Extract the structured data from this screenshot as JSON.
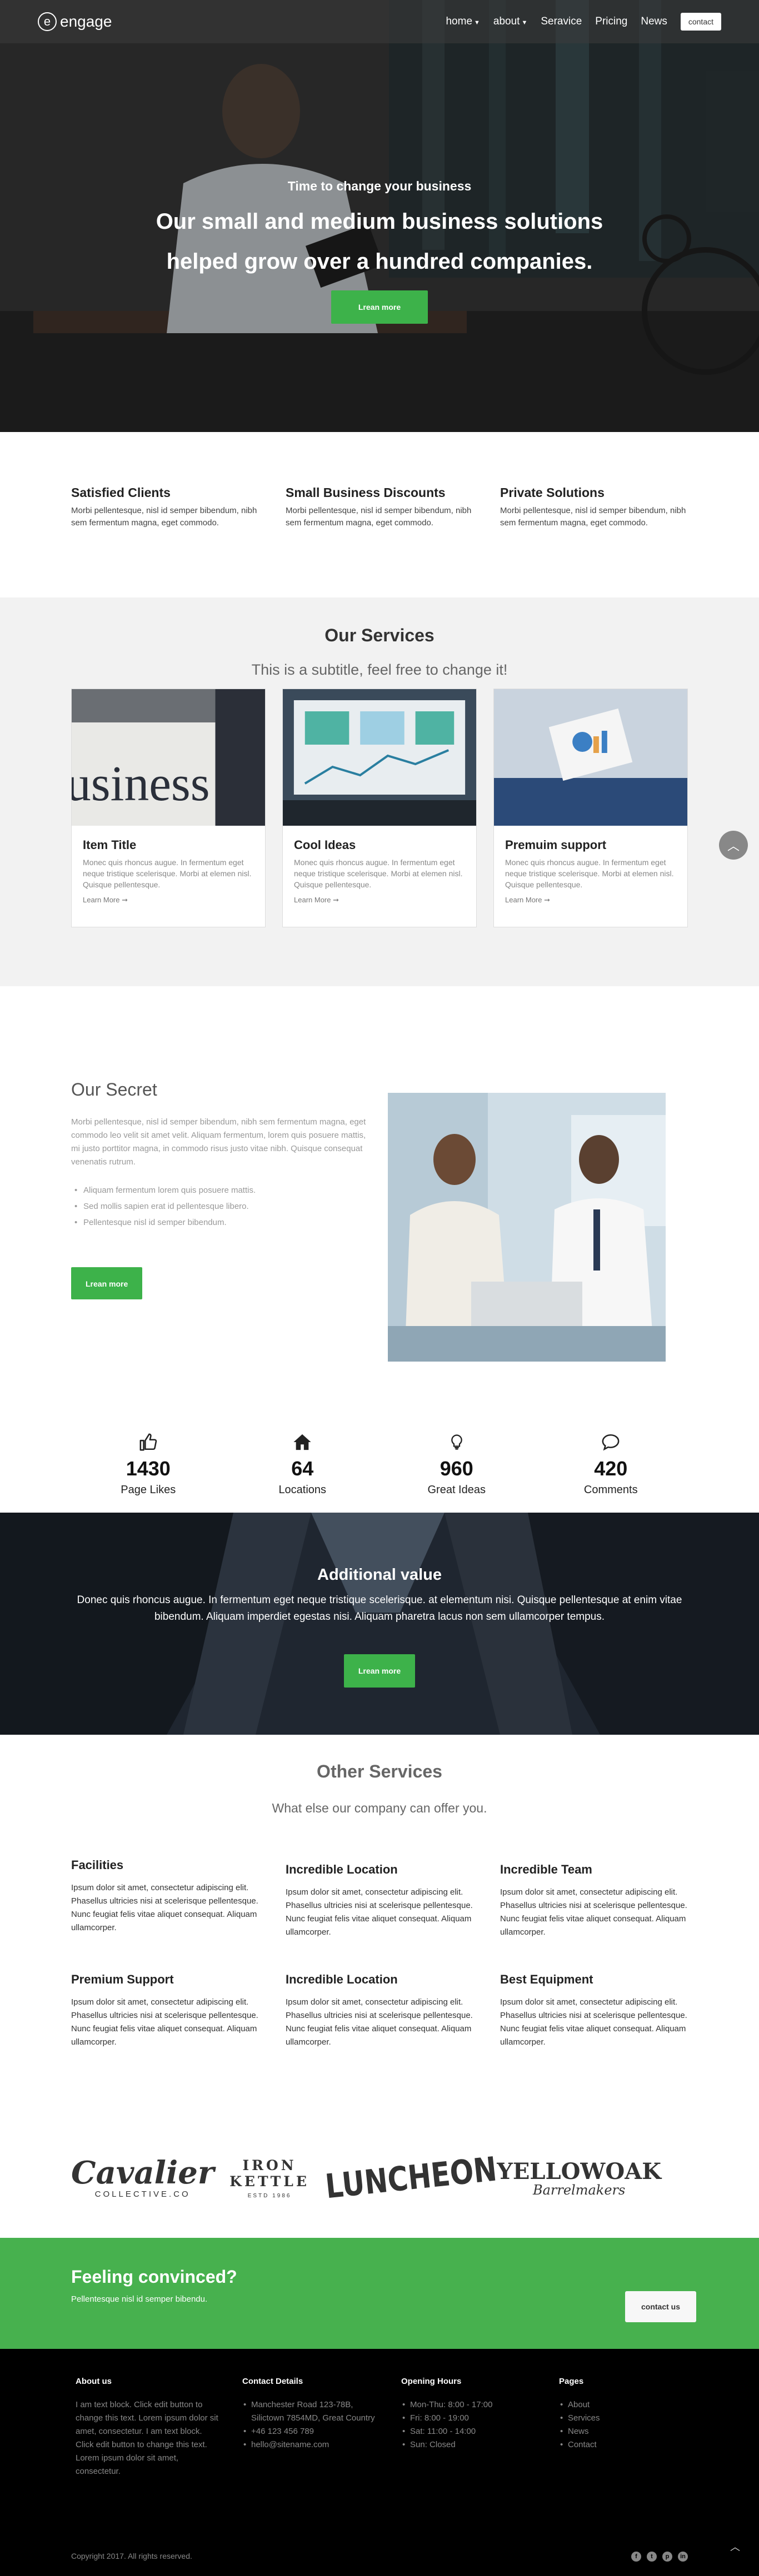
{
  "nav": {
    "brand": "engage",
    "links": [
      "home",
      "about",
      "Seravice",
      "Pricing",
      "News"
    ],
    "contact_label": "contact"
  },
  "hero": {
    "kicker": "Time to change your business",
    "title_line1": "Our small and medium business solutions",
    "title_line2": "helped grow over a hundred companies.",
    "button_label": "Lrean more"
  },
  "features": [
    {
      "title": "Satisfied Clients",
      "text": "Morbi pellentesque, nisl id semper bibendum, nibh sem fermentum magna, eget commodo."
    },
    {
      "title": "Small Business Discounts",
      "text": "Morbi pellentesque, nisl id semper bibendum, nibh sem fermentum magna, eget commodo."
    },
    {
      "title": "Private Solutions",
      "text": "Morbi pellentesque, nisl id semper bibendum, nibh sem fermentum magna, eget commodo."
    }
  ],
  "services": {
    "title": "Our Services",
    "subtitle": "This is a subtitle, feel free to change it!",
    "cards": [
      {
        "title": "Item Title",
        "text": "Monec quis rhoncus augue. In fermentum eget neque tristique scelerisque. Morbi at elemen nisl. Quisque pellentesque.",
        "link": "Learn More ➞"
      },
      {
        "title": "Cool Ideas",
        "text": "Monec quis rhoncus augue. In fermentum eget neque tristique scelerisque. Morbi at elemen nisl. Quisque pellentesque.",
        "link": "Learn More ➞"
      },
      {
        "title": "Premuim support",
        "text": "Monec quis rhoncus augue. In fermentum eget neque tristique scelerisque. Morbi at elemen nisl. Quisque pellentesque.",
        "link": "Learn More ➞"
      }
    ]
  },
  "secret": {
    "title": "Our Secret",
    "text": "Morbi pellentesque, nisl id semper bibendum, nibh sem fermentum magna, eget commodo leo velit sit amet velit. Aliquam fermentum, lorem quis posuere mattis, mi justo porttitor magna, in commodo risus justo vitae nibh. Quisque consequat venenatis rutrum.",
    "list": [
      "Aliquam fermentum lorem quis posuere mattis.",
      "Sed mollis sapien erat id pellentesque libero.",
      "Pellentesque nisl id semper bibendum."
    ],
    "button_label": "Lrean more"
  },
  "stats": [
    {
      "icon": "thumbs-up-icon",
      "value": "1430",
      "label": "Page Likes"
    },
    {
      "icon": "home-icon",
      "value": "64",
      "label": "Locations"
    },
    {
      "icon": "lightbulb-icon",
      "value": "960",
      "label": "Great Ideas"
    },
    {
      "icon": "comment-icon",
      "value": "420",
      "label": "Comments"
    }
  ],
  "additional": {
    "title": "Additional value",
    "text": "Donec quis rhoncus augue. In fermentum eget neque tristique scelerisque. at elementum nisi. Quisque pellentesque at enim vitae bibendum. Aliquam imperdiet egestas nisi. Aliquam pharetra lacus non sem ullamcorper tempus.",
    "button_label": "Lrean more"
  },
  "other": {
    "title": "Other Services",
    "subtitle": "What else our company can offer you.",
    "items": [
      {
        "title": "Facilities",
        "text": "Ipsum dolor sit amet, consectetur adipiscing elit. Phasellus ultricies nisi at scelerisque pellentesque. Nunc feugiat felis vitae aliquet consequat. Aliquam ullamcorper."
      },
      {
        "title": "Incredible Location",
        "text": "Ipsum dolor sit amet, consectetur adipiscing elit. Phasellus ultricies nisi at scelerisque pellentesque. Nunc feugiat felis vitae aliquet consequat. Aliquam ullamcorper."
      },
      {
        "title": "Incredible Team",
        "text": "Ipsum dolor sit amet, consectetur adipiscing elit. Phasellus ultricies nisi at scelerisque pellentesque. Nunc feugiat felis vitae aliquet consequat. Aliquam ullamcorper."
      },
      {
        "title": "Premium Support",
        "text": "Ipsum dolor sit amet, consectetur adipiscing elit. Phasellus ultricies nisi at scelerisque pellentesque. Nunc feugiat felis vitae aliquet consequat. Aliquam ullamcorper."
      },
      {
        "title": "Incredible Location",
        "text": "Ipsum dolor sit amet, consectetur adipiscing elit. Phasellus ultricies nisi at scelerisque pellentesque. Nunc feugiat felis vitae aliquet consequat. Aliquam ullamcorper."
      },
      {
        "title": "Best Equipment",
        "text": "Ipsum dolor sit amet, consectetur adipiscing elit. Phasellus ultricies nisi at scelerisque pellentesque. Nunc feugiat felis vitae aliquet consequat. Aliquam ullamcorper."
      }
    ]
  },
  "logos": {
    "cavalier": "Cavalier",
    "cavalier_sub": "COLLECTIVE.CO",
    "ironkettle": "IRON KETTLE",
    "ironkettle_sub": "ESTD 1986",
    "luncheon": "LUNCHEON",
    "yellowoak": "YELLOWOAK",
    "yellowoak_sub": "Barrelmakers"
  },
  "cta": {
    "title": "Feeling convinced?",
    "text": "Pellentesque nisl id semper bibendu.",
    "button_label": "contact us"
  },
  "footer": {
    "about_title": "About us",
    "about_text": "I am text block. Click edit button to change this text. Lorem ipsum dolor sit amet, consectetur. I am text block. Click edit button to change this text. Lorem ipsum dolor sit amet, consectetur.",
    "contact_title": "Contact Details",
    "contact_items": [
      "Manchester Road 123-78B, Silictown 7854MD, Great Country",
      "+46 123 456 789",
      "hello@sitename.com"
    ],
    "hours_title": "Opening Hours",
    "hours_items": [
      "Mon-Thu: 8:00 - 17:00",
      "Fri: 8:00 - 19:00",
      "Sat: 11:00 - 14:00",
      "Sun: Closed"
    ],
    "pages_title": "Pages",
    "pages_items": [
      "About",
      "Services",
      "News",
      "Contact"
    ],
    "copyright": "Copyright 2017. All rights reserved.",
    "socials": [
      "facebook-icon",
      "twitter-icon",
      "pinterest-icon",
      "linkedin-icon"
    ]
  },
  "colors": {
    "accent": "#3db24a",
    "cta_bg": "#47b14e",
    "footer_bg": "#000000"
  }
}
